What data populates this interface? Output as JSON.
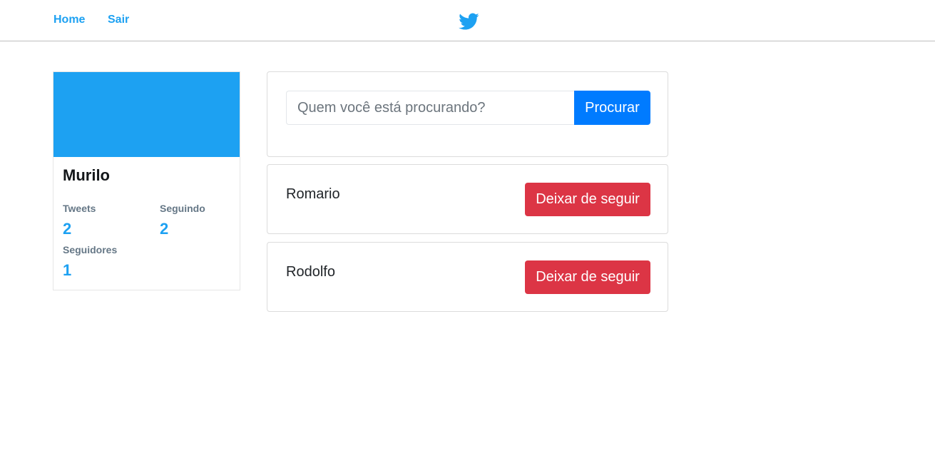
{
  "nav": {
    "home_label": "Home",
    "sair_label": "Sair",
    "logo_icon": "twitter-bird-icon",
    "brand_color": "#1da1f2"
  },
  "profile": {
    "name": "Murilo",
    "cover_color": "#1da1f2",
    "stats": {
      "tweets_label": "Tweets",
      "tweets_value": "2",
      "seguindo_label": "Seguindo",
      "seguindo_value": "2",
      "seguidores_label": "Seguidores",
      "seguidores_value": "1"
    }
  },
  "search": {
    "placeholder": "Quem você está procurando?",
    "value": "",
    "button_label": "Procurar",
    "button_color": "#007bff"
  },
  "following": [
    {
      "name": "Romario",
      "button_label": "Deixar de seguir"
    },
    {
      "name": "Rodolfo",
      "button_label": "Deixar de seguir"
    }
  ],
  "colors": {
    "danger": "#dc3545"
  }
}
